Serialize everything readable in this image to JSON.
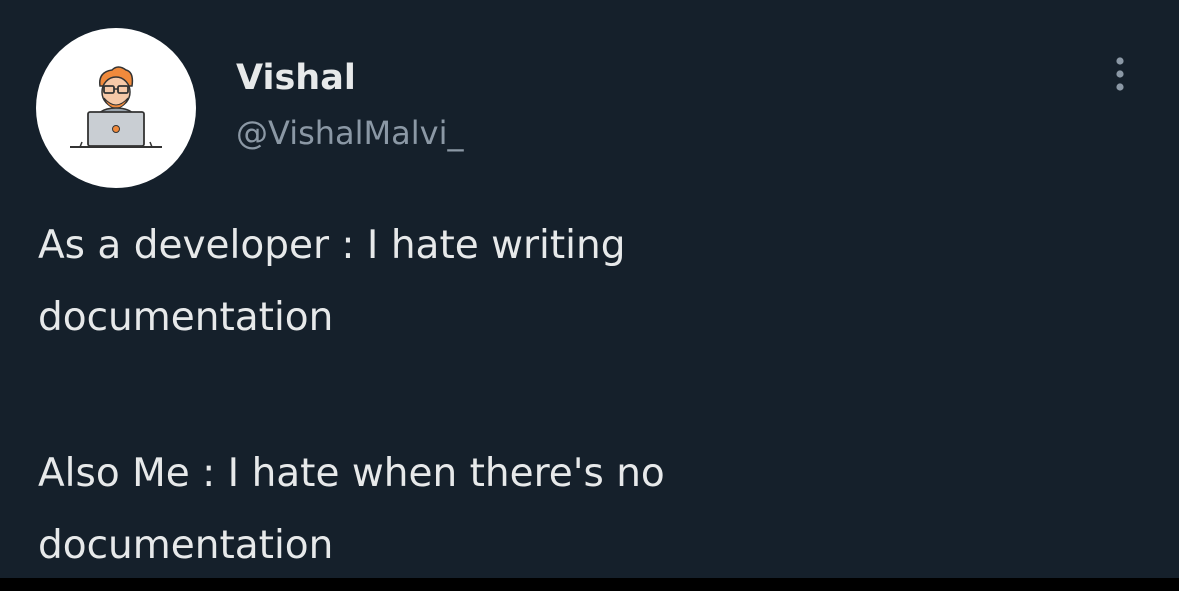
{
  "tweet": {
    "author": {
      "display_name": "Vishal",
      "handle": "@VishalMalvi_",
      "avatar_icon": "developer-at-laptop-icon"
    },
    "menu_icon": "more-vertical-icon",
    "text": {
      "paragraph_1": {
        "line_1": "As a developer : I hate writing",
        "line_2": "documentation"
      },
      "paragraph_2": {
        "line_1": "Also Me : I hate when there's no",
        "line_2": "documentation"
      }
    }
  },
  "colors": {
    "background": "#15202b",
    "outer_background": "#000000",
    "primary_text": "#e7e9ea",
    "secondary_text": "#8b98a5",
    "avatar_background": "#ffffff",
    "avatar_hair": "#f08a3c",
    "avatar_skin": "#f6c9a8",
    "avatar_shirt": "#9aa4ad",
    "avatar_laptop": "#c9ced3",
    "avatar_laptop_dot": "#f08a3c"
  }
}
